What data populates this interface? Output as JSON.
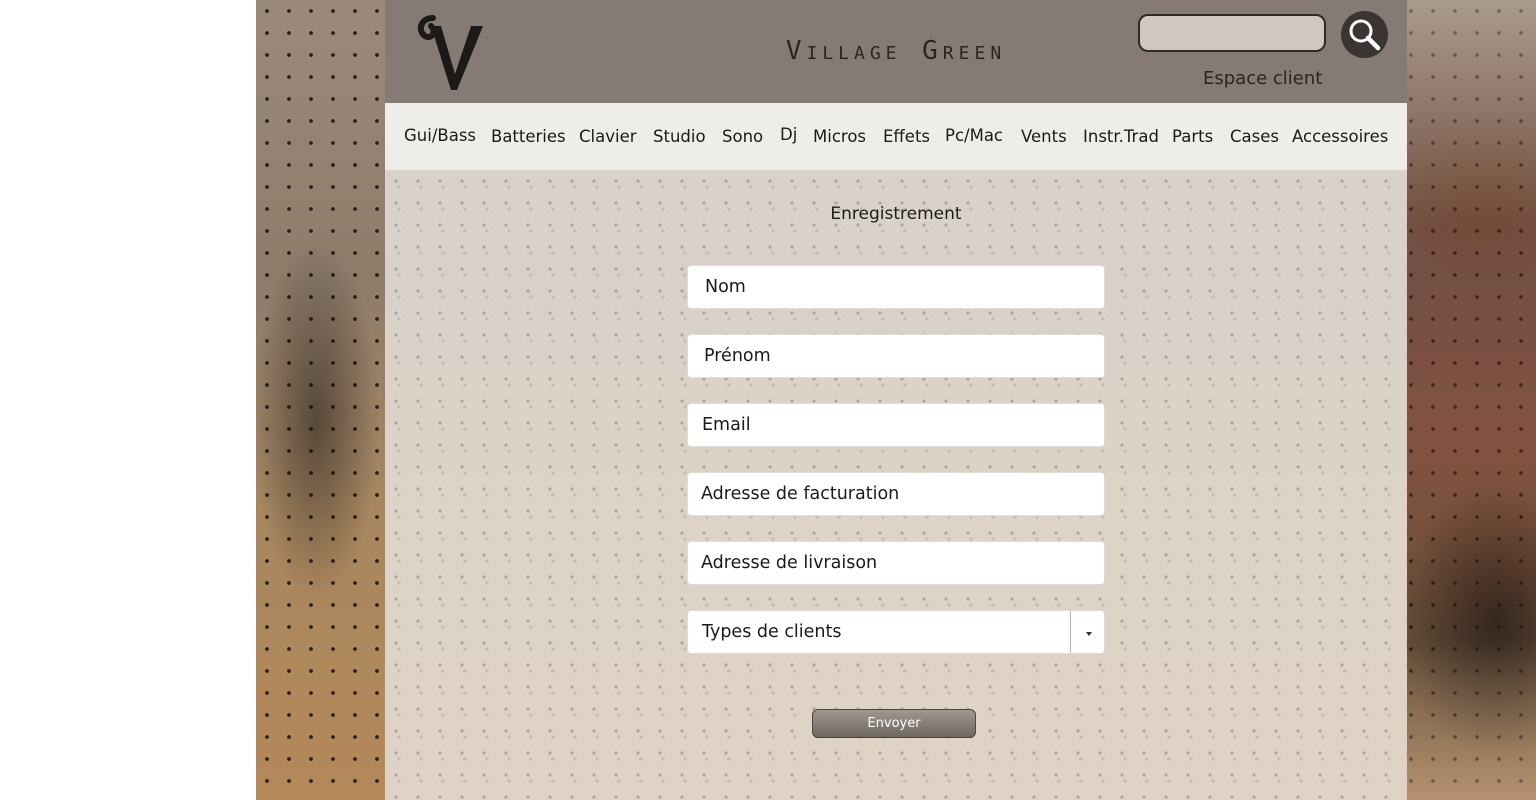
{
  "header": {
    "site_title": "Village Green",
    "search": {
      "value": "",
      "placeholder": ""
    },
    "account_link": "Espace client"
  },
  "nav": {
    "items": [
      {
        "label": "Gui/Bass"
      },
      {
        "label": "Batteries"
      },
      {
        "label": "Clavier"
      },
      {
        "label": "Studio"
      },
      {
        "label": "Sono"
      },
      {
        "label": "Dj"
      },
      {
        "label": "Micros"
      },
      {
        "label": "Effets"
      },
      {
        "label": "Pc/Mac"
      },
      {
        "label": "Vents"
      },
      {
        "label": "Instr.Trad"
      },
      {
        "label": "Parts"
      },
      {
        "label": "Cases"
      },
      {
        "label": "Accessoires"
      }
    ]
  },
  "form": {
    "title": "Enregistrement",
    "fields": {
      "nom": "Nom",
      "prenom": "Prénom",
      "email": "Email",
      "adresse_facturation": "Adresse de facturation",
      "adresse_livraison": "Adresse de livraison",
      "types_clients": "Types de clients"
    },
    "submit_label": "Envoyer"
  },
  "icons": {
    "logo": "v-logo-icon",
    "search": "search-icon",
    "dropdown": "caret-down-icon"
  },
  "colors": {
    "header_bg": "#857b74",
    "nav_bg": "#efede9",
    "search_button": "#3a3532"
  }
}
